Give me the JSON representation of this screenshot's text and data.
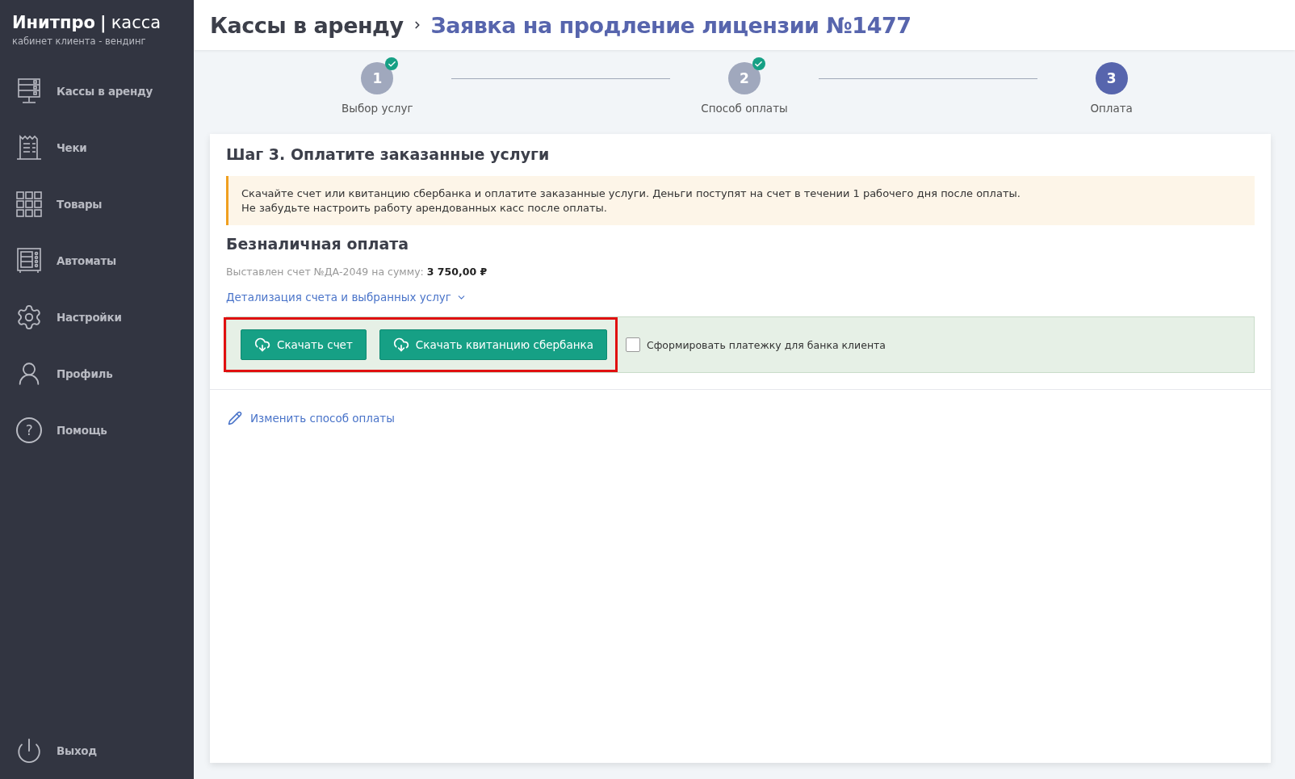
{
  "brand": {
    "name": "Инитпро",
    "separator": "|",
    "product": "касса",
    "subtitle": "кабинет клиента - вендинг"
  },
  "sidebar": {
    "items": [
      {
        "kind": "register",
        "label": "Кассы в аренду"
      },
      {
        "kind": "receipt",
        "label": "Чеки"
      },
      {
        "kind": "grid",
        "label": "Товары"
      },
      {
        "kind": "machine",
        "label": "Автоматы"
      },
      {
        "kind": "gear",
        "label": "Настройки"
      },
      {
        "kind": "person",
        "label": "Профиль"
      },
      {
        "kind": "help",
        "label": "Помощь",
        "glyph": "?"
      }
    ],
    "logout": {
      "label": "Выход"
    }
  },
  "header": {
    "parent": "Кассы в аренду",
    "title": "Заявка на продление лицензии №1477"
  },
  "steps": [
    {
      "number": "1",
      "label": "Выбор услуг",
      "done": true,
      "selected": false
    },
    {
      "number": "2",
      "label": "Способ оплаты",
      "done": true,
      "selected": false
    },
    {
      "number": "3",
      "label": "Оплата",
      "done": false,
      "selected": true
    }
  ],
  "card": {
    "title": "Шаг 3. Оплатите заказанные услуги",
    "notice": [
      "Скачайте счет или квитанцию сбербанка и оплатите заказанные услуги. Деньги поступят на счет в течении 1 рабочего дня после оплаты.",
      "Не забудьте настроить работу арендованных касс после оплаты."
    ],
    "section_title": "Безналичная оплата",
    "invoice": "Выставлен счет №ДА-2049 на сумму: **3 750,00 ₽**",
    "details_link": "Детализация счета и выбранных услуг",
    "buttons": [
      "Скачать счет",
      "Скачать квитанцию сбербанка"
    ],
    "highlighted": true,
    "checkbox": {
      "label": "Сформировать платежку для банка клиента",
      "checked": false
    },
    "change_link": "Изменить способ оплаты"
  }
}
